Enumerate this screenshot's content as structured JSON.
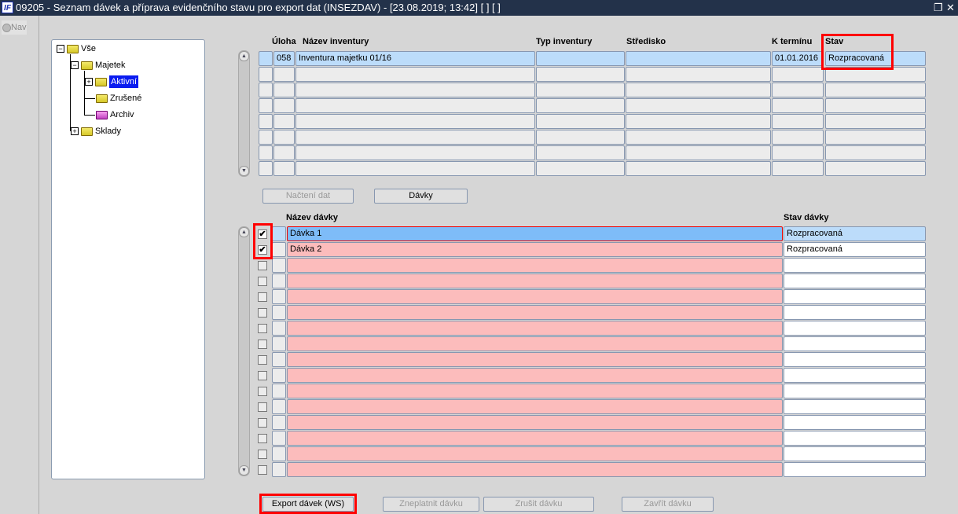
{
  "window": {
    "title": "09205 - Seznam dávek a příprava evidenčního stavu pro export dat (INSEZDAV) - [23.08.2019; 13:42]  [ ]  [ ]",
    "logo": "IF",
    "restore_icon": "❐",
    "close_icon": "✕"
  },
  "nav": {
    "label": "Nav"
  },
  "tree": {
    "root": "Vše",
    "majetek": "Majetek",
    "aktivni": "Aktivní",
    "zrusene": "Zrušené",
    "archiv": "Archiv",
    "sklady": "Sklady"
  },
  "inventory_table": {
    "headers": {
      "uloha": "Úloha",
      "nazev": "Název inventury",
      "typ": "Typ inventury",
      "stredisko": "Středisko",
      "k_terminu": "K termínu",
      "stav": "Stav"
    },
    "rows": [
      {
        "uloha": "058",
        "nazev": "Inventura majetku 01/16",
        "typ": "",
        "stredisko": "",
        "k_terminu": "01.01.2016",
        "stav": "Rozpracovaná"
      }
    ],
    "empty_rows": 7
  },
  "buttons": {
    "nacteni_dat": "Načtení dat",
    "davky": "Dávky",
    "export": "Export dávek (WS)",
    "zneplatnit": "Zneplatnit dávku",
    "zrusit": "Zrušit dávku",
    "zavrit": "Zavřít dávku"
  },
  "batch_table": {
    "headers": {
      "nazev": "Název dávky",
      "stav": "Stav dávky"
    },
    "rows": [
      {
        "checked": true,
        "nazev": "Dávka 1",
        "stav": "Rozpracovaná"
      },
      {
        "checked": true,
        "nazev": "Dávka 2",
        "stav": "Rozpracovaná"
      }
    ],
    "empty_rows": 14
  }
}
